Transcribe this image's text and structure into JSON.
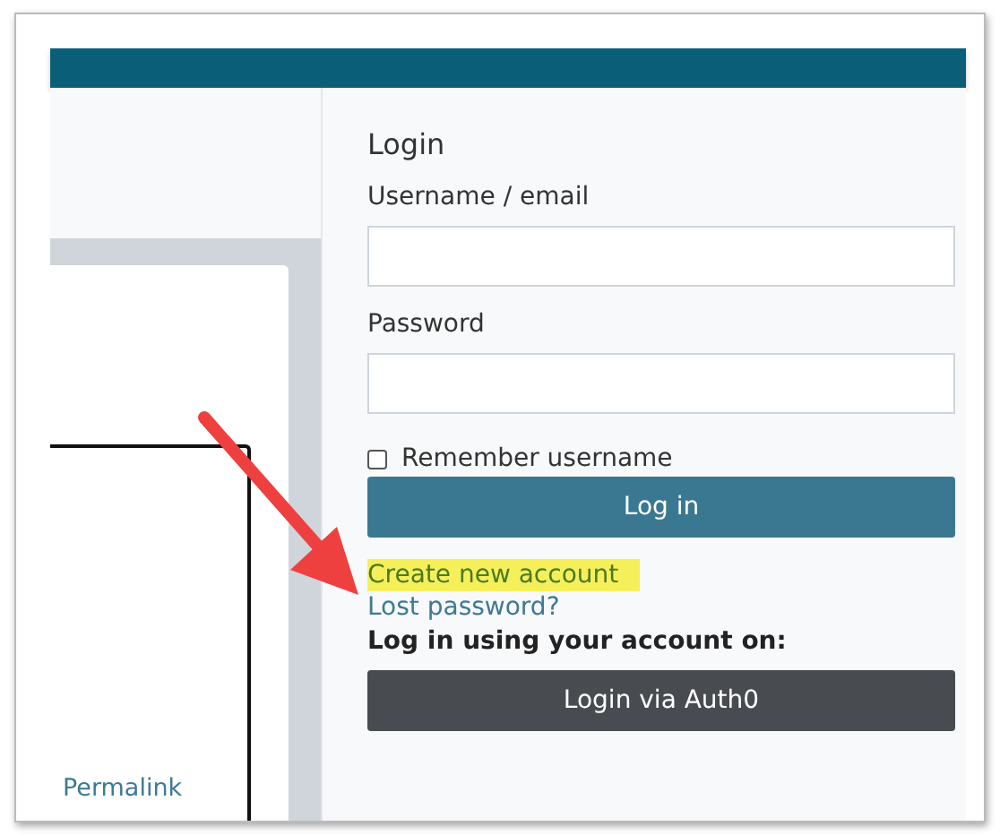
{
  "left_card": {
    "link": "Permalink"
  },
  "login": {
    "title": "Login",
    "username": {
      "label": "Username / email"
    },
    "password": {
      "label": "Password"
    },
    "remember": {
      "label": "Remember username",
      "checked": false
    },
    "submit": "Log in",
    "links": [
      {
        "text": "Create new account",
        "highlighted": true
      },
      {
        "text": "Lost password?",
        "highlighted": false
      }
    ],
    "sso_heading": "Log in using your account on:",
    "sso_button": "Login via Auth0"
  }
}
